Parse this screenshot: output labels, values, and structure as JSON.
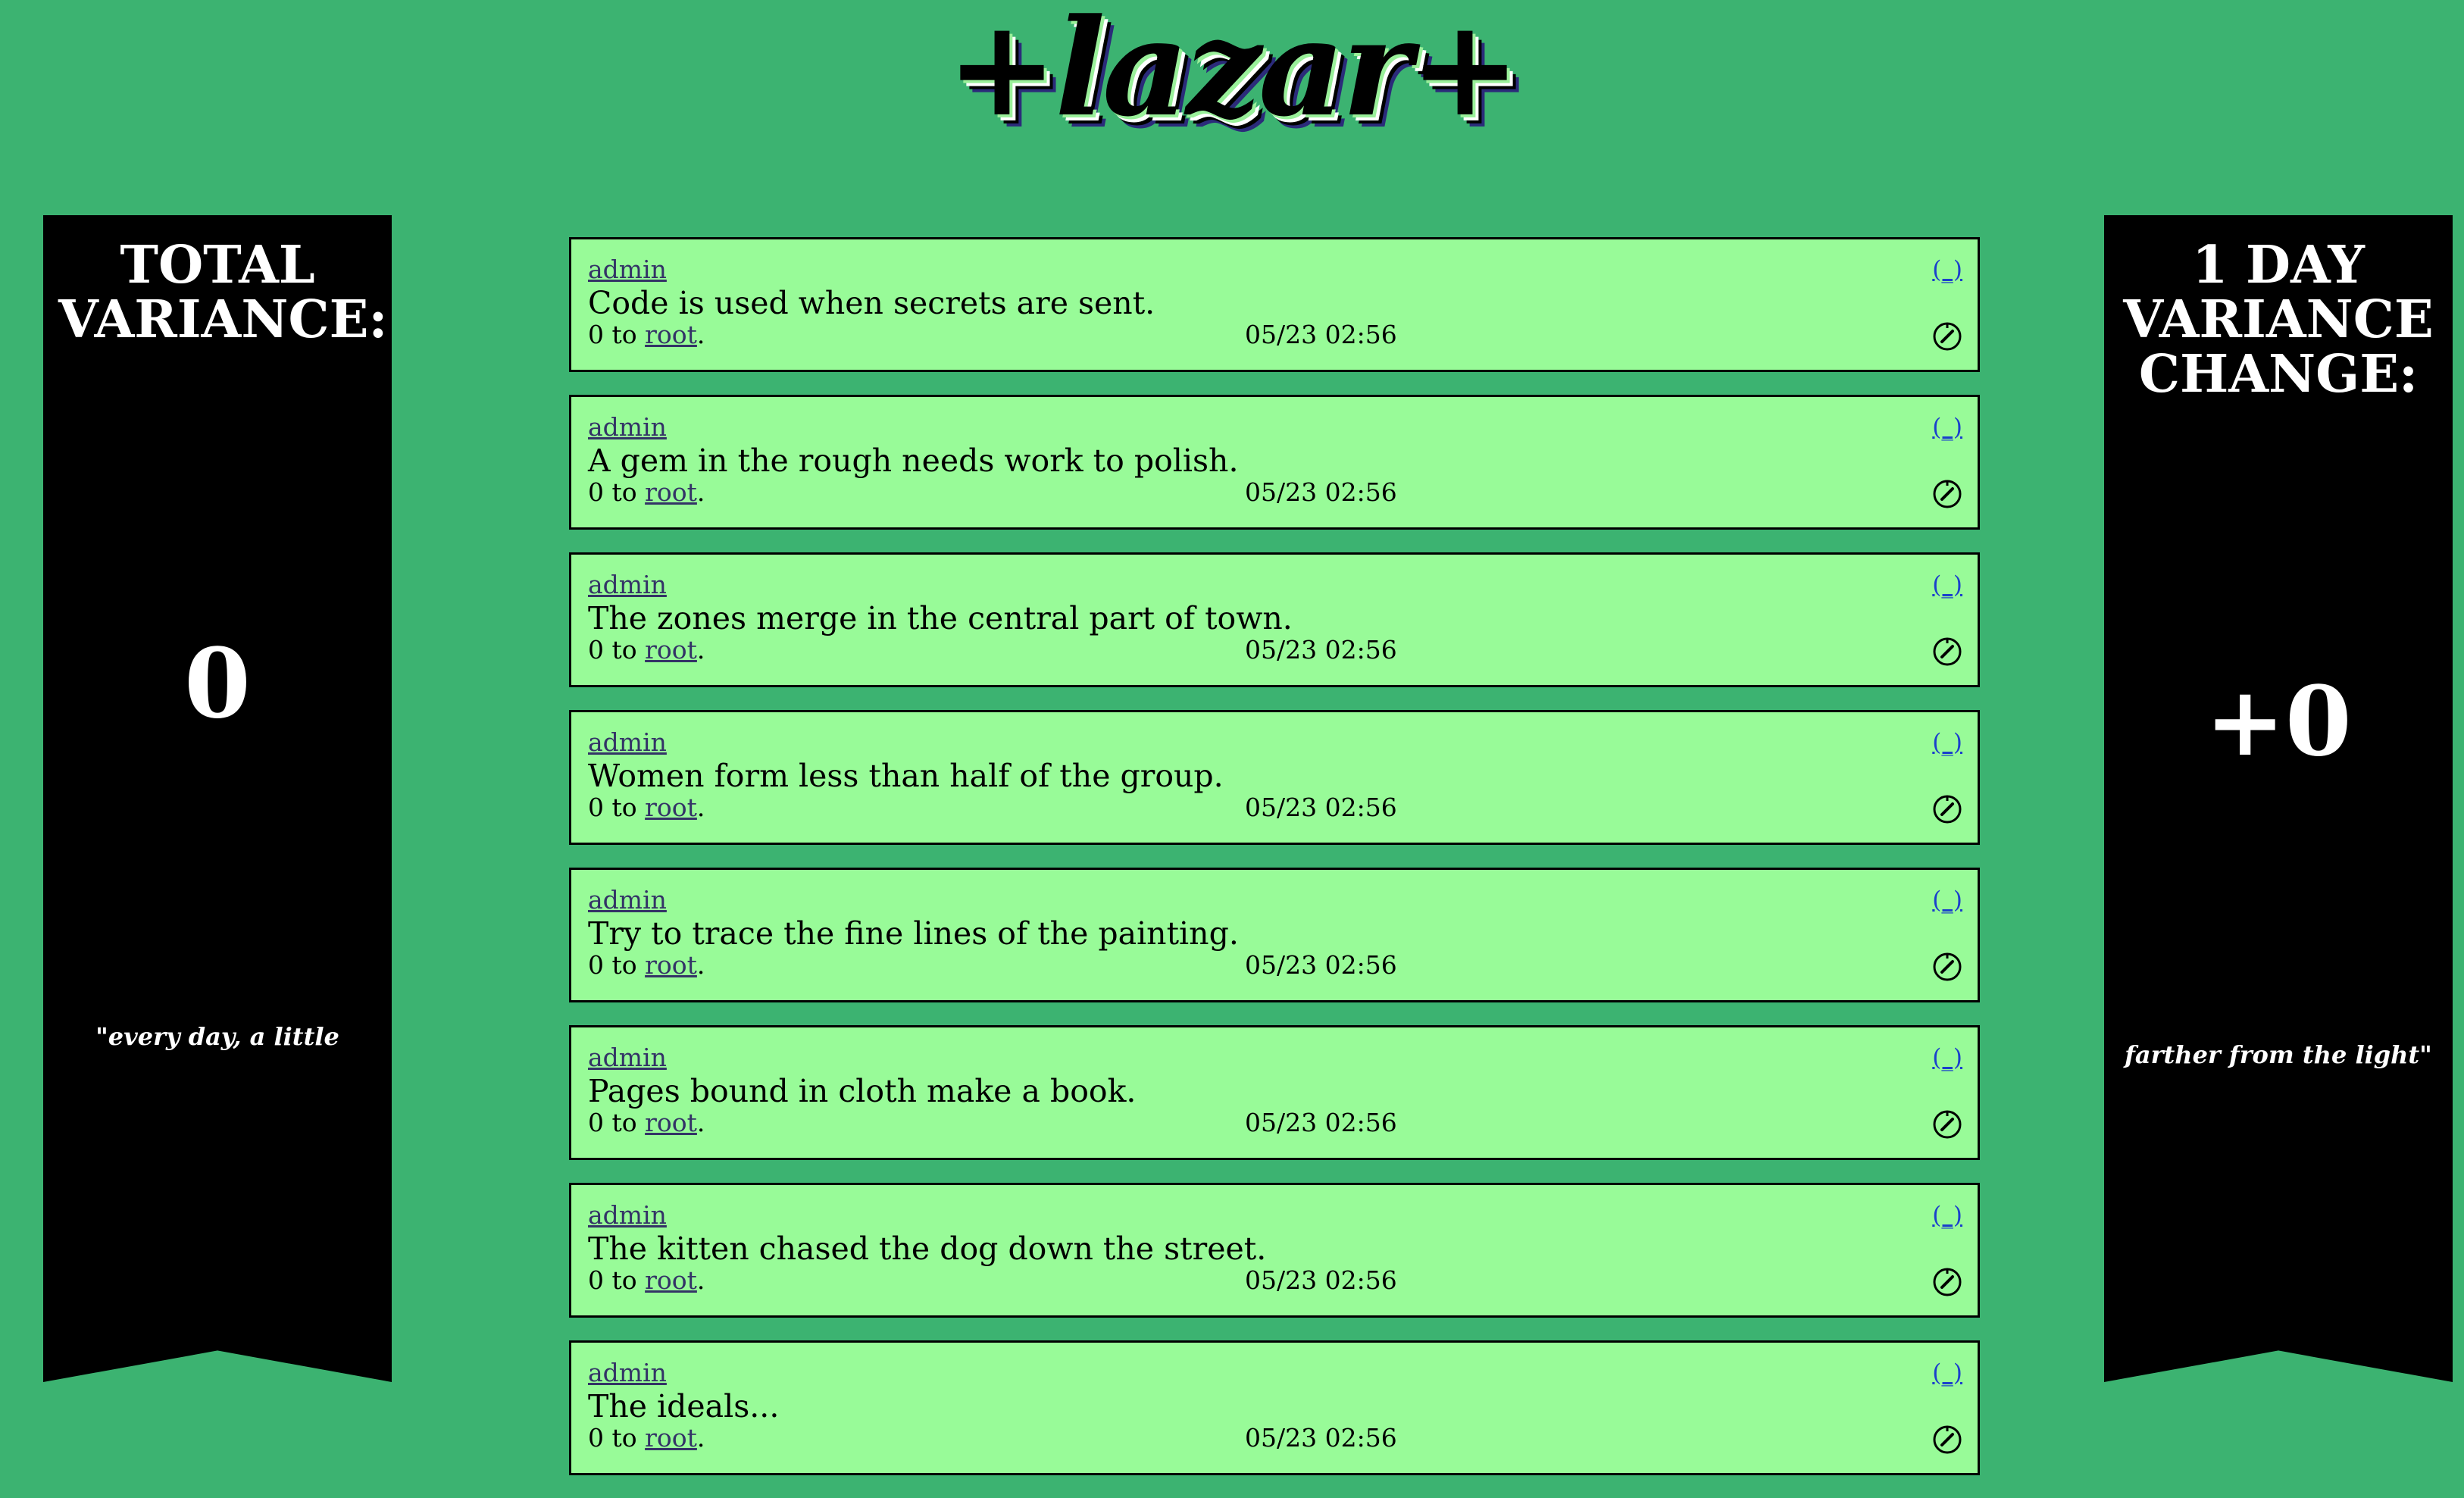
{
  "logo": {
    "text": "+lazar+"
  },
  "left_banner": {
    "title_line1": "TOTAL",
    "title_line2": "VARIANCE:",
    "value": "0",
    "quote": "\"every day, a little"
  },
  "right_banner": {
    "title_line1": "1 DAY",
    "title_line2": "VARIANCE",
    "title_line3": "CHANGE:",
    "value": "+0",
    "quote": "farther from the light\""
  },
  "posts": [
    {
      "user": "admin",
      "flag": "(_)",
      "text": "Code is used when secrets are sent.",
      "prefix": "0 to ",
      "target": "root",
      "suffix": ".",
      "time": "05/23 02:56"
    },
    {
      "user": "admin",
      "flag": "(_)",
      "text": "A gem in the rough needs work to polish.",
      "prefix": "0 to ",
      "target": "root",
      "suffix": ".",
      "time": "05/23 02:56"
    },
    {
      "user": "admin",
      "flag": "(_)",
      "text": "The zones merge in the central part of town.",
      "prefix": "0 to ",
      "target": "root",
      "suffix": ".",
      "time": "05/23 02:56"
    },
    {
      "user": "admin",
      "flag": "(_)",
      "text": "Women form less than half of the group.",
      "prefix": "0 to ",
      "target": "root",
      "suffix": ".",
      "time": "05/23 02:56"
    },
    {
      "user": "admin",
      "flag": "(_)",
      "text": "Try to trace the fine lines of the painting.",
      "prefix": "0 to ",
      "target": "root",
      "suffix": ".",
      "time": "05/23 02:56"
    },
    {
      "user": "admin",
      "flag": "(_)",
      "text": "Pages bound in cloth make a book.",
      "prefix": "0 to ",
      "target": "root",
      "suffix": ".",
      "time": "05/23 02:56"
    },
    {
      "user": "admin",
      "flag": "(_)",
      "text": "The kitten chased the dog down the street.",
      "prefix": "0 to ",
      "target": "root",
      "suffix": ".",
      "time": "05/23 02:56"
    },
    {
      "user": "admin",
      "flag": "(_)",
      "text": "The ideals...",
      "prefix": "0 to ",
      "target": "root",
      "suffix": ".",
      "time": "05/23 02:56"
    }
  ],
  "icons": {
    "post_action": "compass-icon"
  },
  "colors": {
    "background": "#3cb371",
    "card": "#98fb98",
    "banner": "#000000",
    "link": "#333366",
    "flag_link": "#1a3fcc"
  }
}
